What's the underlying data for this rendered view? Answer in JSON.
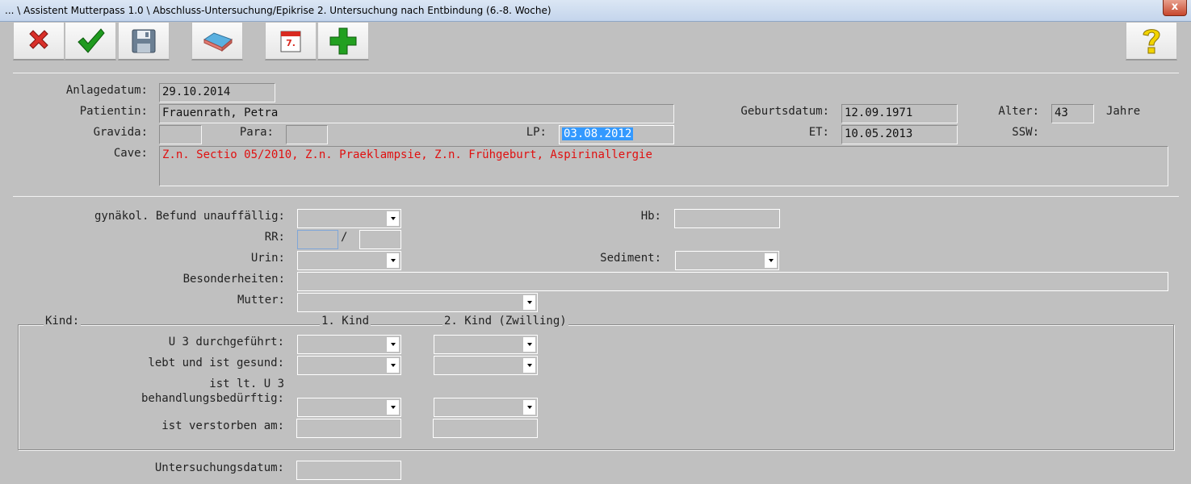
{
  "window": {
    "title": "... \\ Assistent Mutterpass 1.0 \\ Abschluss-Untersuchung/Epikrise 2. Untersuchung nach Entbindung (6.-8. Woche)",
    "close_glyph": "x"
  },
  "toolbar": {
    "buttons": [
      {
        "icon": "cancel-icon",
        "color": "#d9302a"
      },
      {
        "icon": "confirm-icon",
        "color": "#1f9a1f"
      },
      {
        "icon": "save-icon",
        "color": "#6b7f93"
      },
      {
        "icon": "eraser-icon",
        "color": "#e37b72"
      },
      {
        "icon": "calendar-icon",
        "color": "#d82a20"
      },
      {
        "icon": "add-icon",
        "color": "#22a020"
      },
      {
        "icon": "help-icon",
        "color": "#f2d400"
      }
    ],
    "calendar_day": "7."
  },
  "header": {
    "anlagedatum_label": "Anlagedatum:",
    "anlagedatum_value": "29.10.2014",
    "patientin_label": "Patientin:",
    "patientin_value": "Frauenrath, Petra",
    "geburtsdatum_label": "Geburtsdatum:",
    "geburtsdatum_value": "12.09.1971",
    "alter_label": "Alter:",
    "alter_value": "43",
    "jahre_label": "Jahre",
    "gravida_label": "Gravida:",
    "gravida_value": "",
    "para_label": "Para:",
    "para_value": "",
    "lp_label": "LP:",
    "lp_value": "03.08.2012",
    "et_label": "ET:",
    "et_value": "10.05.2013",
    "ssw_label": "SSW:",
    "cave_label": "Cave:",
    "cave_value": "Z.n. Sectio 05/2010, Z.n. Praeklampsie, Z.n. Frühgeburt, Aspirinallergie"
  },
  "befund": {
    "gynaekol_label": "gynäkol. Befund unauffällig:",
    "gynaekol_value": "",
    "hb_label": "Hb:",
    "hb_value": "",
    "rr_label": "RR:",
    "rr_sys": "",
    "rr_sep": "/",
    "rr_dia": "",
    "urin_label": "Urin:",
    "urin_value": "",
    "sediment_label": "Sediment:",
    "sediment_value": "",
    "besonderheiten_label": "Besonderheiten:",
    "besonderheiten_value": "",
    "mutter_label": "Mutter:",
    "mutter_value": ""
  },
  "kind": {
    "group_label": "Kind:",
    "col1_label": "1. Kind",
    "col2_label": "2. Kind (Zwilling)",
    "u3_label": "U 3 durchgeführt:",
    "lebt_label": "lebt und ist gesund:",
    "behandlung_label_1": "ist lt. U 3",
    "behandlung_label_2": "behandlungsbedürftig:",
    "verstorben_label": "ist verstorben am:",
    "u3_k1": "",
    "u3_k2": "",
    "lebt_k1": "",
    "lebt_k2": "",
    "beh_k1": "",
    "beh_k2": "",
    "verst_k1": "",
    "verst_k2": ""
  },
  "footer": {
    "untersuchungsdatum_label": "Untersuchungsdatum:",
    "untersuchungsdatum_value": ""
  }
}
